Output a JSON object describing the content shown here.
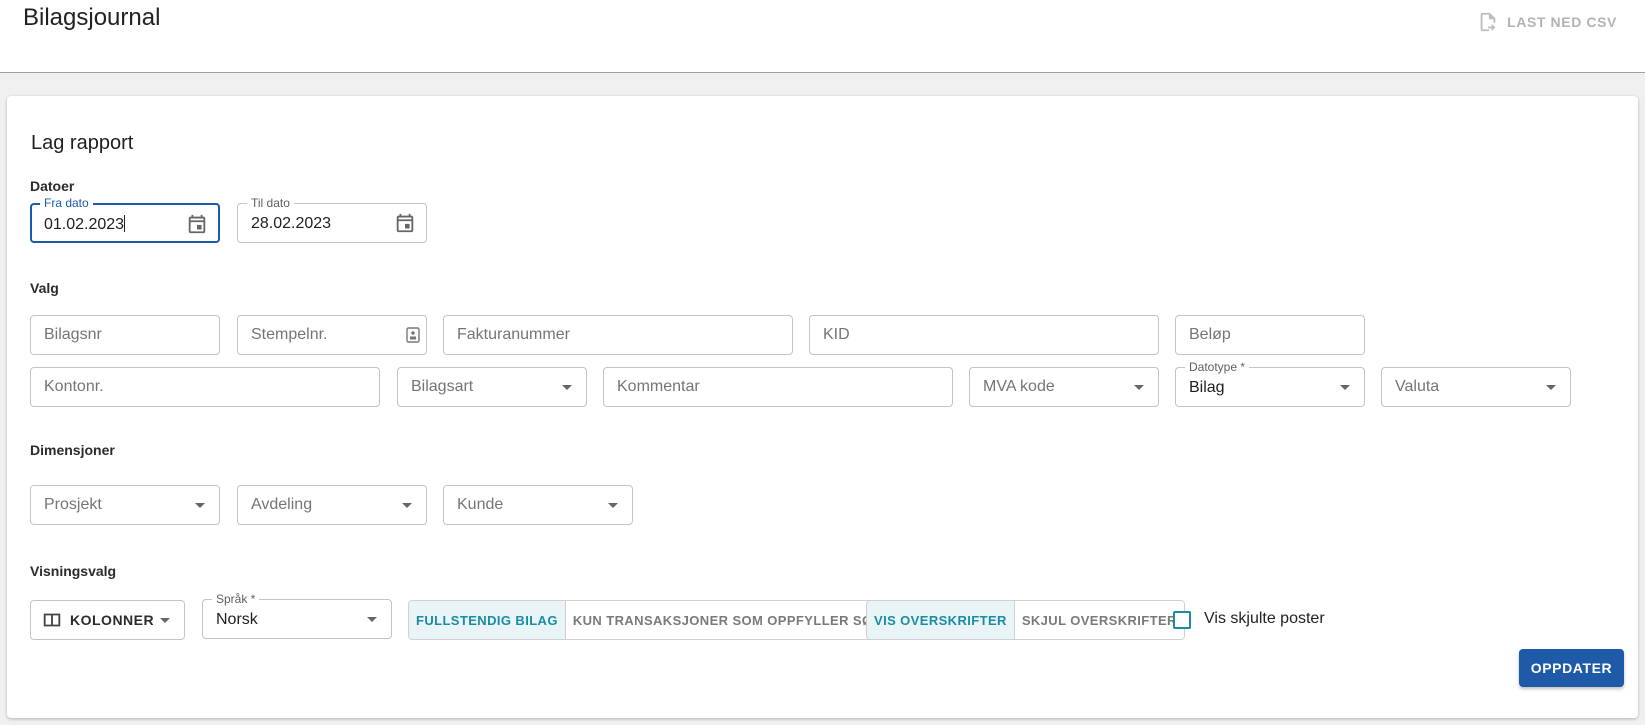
{
  "header": {
    "title": "Bilagsjournal",
    "csv_button": "LAST NED CSV",
    "csv_icon": "file-export-icon"
  },
  "card": {
    "title": "Lag rapport",
    "sections": {
      "dates": "Datoer",
      "options": "Valg",
      "dimensions": "Dimensjoner",
      "display": "Visningsvalg"
    },
    "dates": {
      "from": {
        "label": "Fra dato",
        "value": "01.02.2023"
      },
      "to": {
        "label": "Til dato",
        "value": "28.02.2023"
      }
    },
    "options": {
      "bilagsnr": "Bilagsnr",
      "stempelnr": "Stempelnr.",
      "fakturanummer": "Fakturanummer",
      "kid": "KID",
      "belop": "Beløp",
      "kontonr": "Kontonr.",
      "bilagsart": "Bilagsart",
      "kommentar": "Kommentar",
      "mva_kode": "MVA kode",
      "datotype": {
        "label": "Datotype *",
        "value": "Bilag"
      },
      "valuta": "Valuta"
    },
    "dimensions": {
      "prosjekt": "Prosjekt",
      "avdeling": "Avdeling",
      "kunde": "Kunde"
    },
    "display": {
      "kolonner": "KOLONNER",
      "sprak": {
        "label": "Språk *",
        "value": "Norsk"
      },
      "bilag_toggle": {
        "full": "FULLSTENDIG BILAG",
        "transactions": "KUN TRANSAKSJONER SOM OPPFYLLER SØK",
        "selected": "full"
      },
      "heading_toggle": {
        "show": "VIS OVERSKRIFTER",
        "hide": "SKJUL OVERSKRIFTER",
        "selected": "show"
      },
      "show_hidden": {
        "label": "Vis skjulte poster",
        "checked": false
      }
    },
    "update_button": "OPPDATER"
  },
  "colors": {
    "primary": "#1e5aa8",
    "accent": "#1a8ca3",
    "toggle_active_bg": "#e8f4f6"
  }
}
